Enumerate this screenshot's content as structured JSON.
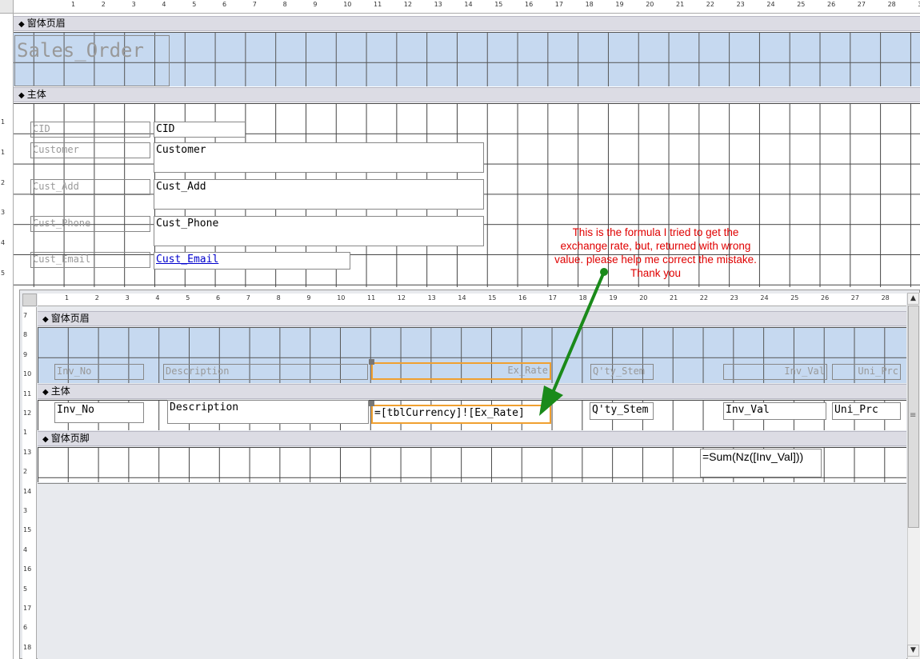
{
  "outer": {
    "ruler_numbers": [
      "1",
      "2",
      "3",
      "4",
      "5",
      "6",
      "7",
      "8",
      "9",
      "10",
      "11",
      "12",
      "13",
      "14",
      "15",
      "16",
      "17",
      "18",
      "19",
      "20",
      "21",
      "22",
      "23",
      "24",
      "25",
      "26",
      "27",
      "28",
      "3"
    ],
    "vruler_numbers": [
      "1",
      "1",
      "2",
      "3",
      "4",
      "5"
    ],
    "header_section": "窗体页眉",
    "body_section": "主体",
    "form_title": "Sales_Order",
    "fields": [
      {
        "label": "CID",
        "value": "CID"
      },
      {
        "label": "Customer",
        "value": "Customer"
      },
      {
        "label": "Cust_Add",
        "value": "Cust_Add"
      },
      {
        "label": "Cust_Phone",
        "value": "Cust_Phone"
      },
      {
        "label": "Cust_Email",
        "value": "Cust_Email"
      }
    ]
  },
  "annotation": {
    "text_lines": [
      "This is the formula I tried to get the",
      "exchange rate, but, returned with wrong",
      "value. please help me correct the mistake.",
      "Thank you"
    ],
    "arrow_color": "#1a8a1a",
    "text_color": "#e00000"
  },
  "subform": {
    "ruler_numbers": [
      "1",
      "2",
      "3",
      "4",
      "5",
      "6",
      "7",
      "8",
      "9",
      "10",
      "11",
      "12",
      "13",
      "14",
      "15",
      "16",
      "17",
      "18",
      "19",
      "20",
      "21",
      "22",
      "23",
      "24",
      "25",
      "26",
      "27",
      "28"
    ],
    "vruler_numbers": [
      "7",
      "8",
      "9",
      "10",
      "11",
      "12",
      "1",
      "13",
      "2",
      "14",
      "3",
      "15",
      "4",
      "16",
      "5",
      "17",
      "6",
      "18"
    ],
    "header_section": "窗体页眉",
    "body_section": "主体",
    "footer_section": "窗体页脚",
    "header_labels": [
      "Inv_No",
      "Description",
      "Ex_Rate",
      "Q'ty_Stem",
      "Inv_Val",
      "Uni_Prc"
    ],
    "body_fields": [
      "Inv_No",
      "Description",
      "=[tblCurrency]![Ex_Rate]",
      "Q'ty_Stem",
      "Inv_Val",
      "Uni_Prc"
    ],
    "footer_sum": "=Sum(Nz([Inv_Val]))"
  },
  "scrollbar": {
    "up": "▲",
    "down": "▼",
    "grip": "≡"
  }
}
